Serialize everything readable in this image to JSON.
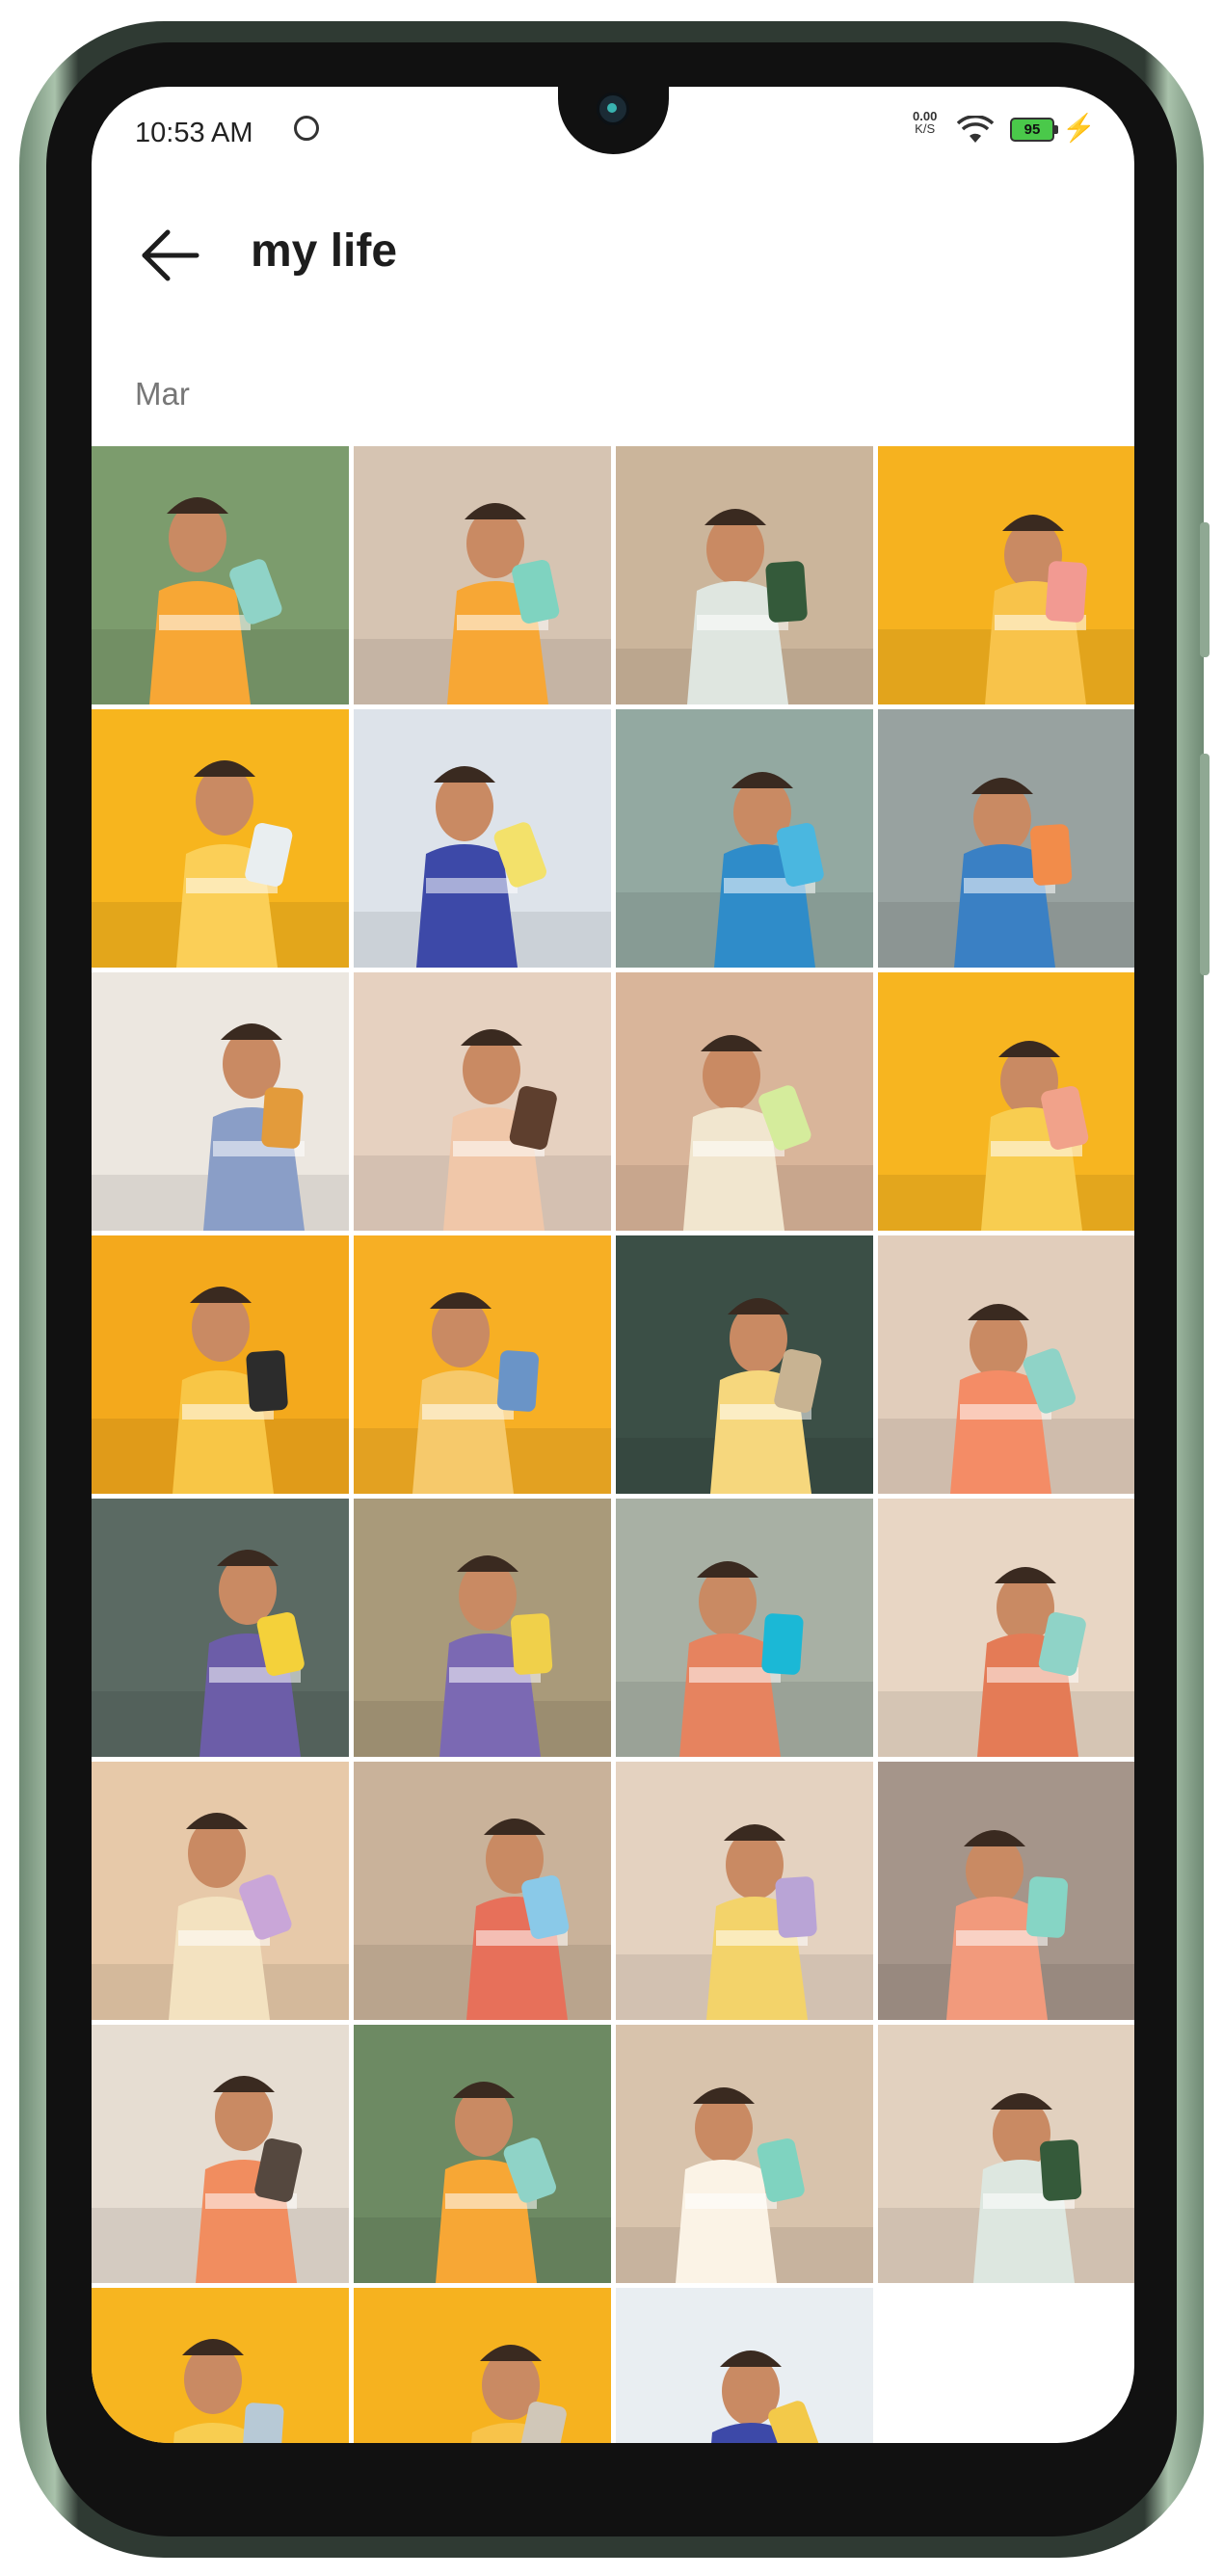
{
  "status_bar": {
    "time": "10:53 AM",
    "net_speed_value": "0.00",
    "net_speed_unit": "K/S",
    "battery_level": "95"
  },
  "header": {
    "title": "my life"
  },
  "section_label": "Mar",
  "colors": {
    "accent_yellow": "#f6b21f",
    "frame_green": "#a9c2ab",
    "title_text": "#1d1d1d"
  },
  "photos": [
    {
      "bg": "#7c9c6d",
      "subj": "#f7a735",
      "acc": "#8fd3c7"
    },
    {
      "bg": "#d6c4b2",
      "subj": "#f7a735",
      "acc": "#7fd3c0"
    },
    {
      "bg": "#cbb59b",
      "subj": "#dfe6e0",
      "acc": "#345a3a"
    },
    {
      "bg": "#f6b21f",
      "subj": "#f8c34a",
      "acc": "#f29a92"
    },
    {
      "bg": "#f7b51e",
      "subj": "#fbcf57",
      "acc": "#e9eef0"
    },
    {
      "bg": "#dde3ea",
      "subj": "#3d49a8",
      "acc": "#f3e16a"
    },
    {
      "bg": "#93a9a1",
      "subj": "#2f8cc9",
      "acc": "#4ab7e0"
    },
    {
      "bg": "#98a2a0",
      "subj": "#3a80c4",
      "acc": "#f28c4a"
    },
    {
      "bg": "#ece7e0",
      "subj": "#8a9ec7",
      "acc": "#e39b3b"
    },
    {
      "bg": "#e6d1c0",
      "subj": "#f0c7a9",
      "acc": "#5e3f2e"
    },
    {
      "bg": "#d9b59a",
      "subj": "#f1e6cf",
      "acc": "#d5ec9c"
    },
    {
      "bg": "#f7b520",
      "subj": "#f8cd50",
      "acc": "#f1a28a"
    },
    {
      "bg": "#f4a91c",
      "subj": "#f8c646",
      "acc": "#2c2c2c"
    },
    {
      "bg": "#f7af24",
      "subj": "#f6c96b",
      "acc": "#6a94c7"
    },
    {
      "bg": "#3b4f46",
      "subj": "#f6d77d",
      "acc": "#c8b392"
    },
    {
      "bg": "#e1cdbb",
      "subj": "#f48c66",
      "acc": "#8fd3c7"
    },
    {
      "bg": "#5b6a63",
      "subj": "#6c5da8",
      "acc": "#f4d13a"
    },
    {
      "bg": "#a99a7a",
      "subj": "#7b69b3",
      "acc": "#f0d04a"
    },
    {
      "bg": "#a8b0a4",
      "subj": "#e6835f",
      "acc": "#1bb8d6"
    },
    {
      "bg": "#e8d6c4",
      "subj": "#e47b56",
      "acc": "#8fd3c7"
    },
    {
      "bg": "#e7c9a9",
      "subj": "#f3e2c0",
      "acc": "#c9a6d8"
    },
    {
      "bg": "#c9b29a",
      "subj": "#e7705a",
      "acc": "#8ac9e8"
    },
    {
      "bg": "#e4d2c0",
      "subj": "#f3d36a",
      "acc": "#b9a4d6"
    },
    {
      "bg": "#a5958a",
      "subj": "#f29a7c",
      "acc": "#86d5c5"
    },
    {
      "bg": "#e6ddd2",
      "subj": "#f18d5f",
      "acc": "#55483f"
    },
    {
      "bg": "#6d8a63",
      "subj": "#f7a735",
      "acc": "#8fd3c7"
    },
    {
      "bg": "#d8c3ac",
      "subj": "#fbf3e6",
      "acc": "#7fd3c0"
    },
    {
      "bg": "#e2d1bf",
      "subj": "#dde7e0",
      "acc": "#355a3a"
    },
    {
      "bg": "#f7b520",
      "subj": "#f8cd50",
      "acc": "#b7c9d6"
    },
    {
      "bg": "#f6b21f",
      "subj": "#f8c34a",
      "acc": "#d0c7b8"
    },
    {
      "bg": "#e9eef2",
      "subj": "#3d49a8",
      "acc": "#f3c949"
    }
  ]
}
